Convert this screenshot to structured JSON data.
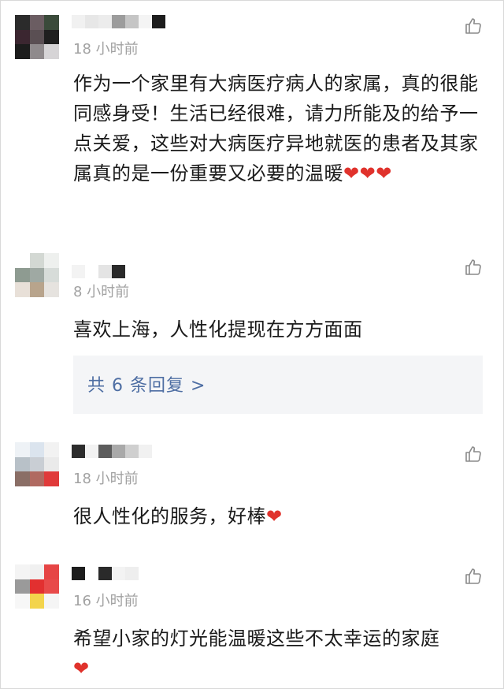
{
  "comments": [
    {
      "time": "18 小时前",
      "text": "作为一个家里有大病医疗病人的家属，真的很能同感身受！生活已经很难，请力所能及的给予一点关爱，这些对大病医疗异地就医的患者及其家属真的是一份重要又必要的温暖",
      "emoji": "❤❤❤"
    },
    {
      "time": "8 小时前",
      "text": "喜欢上海，人性化提现在方方面面",
      "replies_label": "共 6 条回复 >"
    },
    {
      "time": "18 小时前",
      "text": "很人性化的服务，好棒",
      "emoji": "❤"
    },
    {
      "time": "16 小时前",
      "text": "希望小家的灯光能温暖这些不太幸运的家庭",
      "emoji": "❤"
    }
  ],
  "icons": {
    "like": "thumbs-up-icon",
    "heart": "red-heart-emoji"
  },
  "colors": {
    "time": "#a2a2a2",
    "text": "#1a1a1a",
    "reply_link": "#4e6ea3",
    "reply_bg": "#f4f5f7",
    "heart": "#e0322c"
  }
}
